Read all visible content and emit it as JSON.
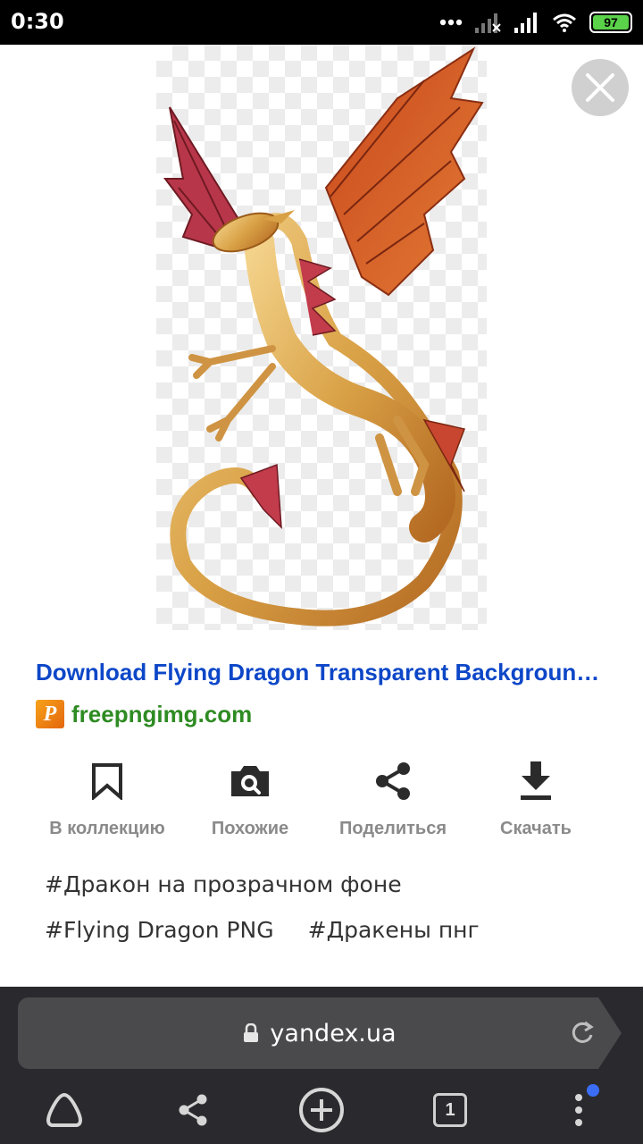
{
  "status_bar": {
    "time": "0:30",
    "battery": "97"
  },
  "result": {
    "title": "Download Flying Dragon Transparent Backgroun…",
    "source": "freepngimg.com",
    "favicon_letter": "P"
  },
  "actions": [
    {
      "label": "В коллекцию",
      "icon": "bookmark-icon"
    },
    {
      "label": "Похожие",
      "icon": "camera-search-icon"
    },
    {
      "label": "Поделиться",
      "icon": "share-icon"
    },
    {
      "label": "Скачать",
      "icon": "download-icon"
    }
  ],
  "tags": [
    "#Дракон на прозрачном фоне",
    "#Flying Dragon PNG",
    "#Дракены пнг"
  ],
  "browser": {
    "url": "yandex.ua",
    "tab_count": "1"
  },
  "colors": {
    "title": "#0d47c8",
    "source": "#2e8b22",
    "browser_bg": "#2a2a2e",
    "notify": "#3b6df5"
  }
}
